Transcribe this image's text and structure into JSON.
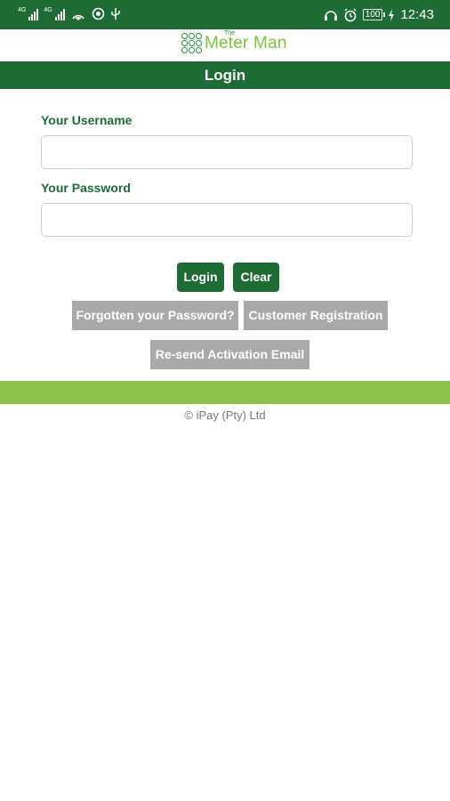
{
  "status_bar": {
    "signal1_label": "4G",
    "signal2_label": "4G",
    "battery": "100",
    "time": "12:43"
  },
  "brand": {
    "small_text": "The",
    "name": "Meter Man"
  },
  "page": {
    "title": "Login"
  },
  "form": {
    "username_label": "Your Username",
    "username_value": "",
    "password_label": "Your Password",
    "password_value": ""
  },
  "buttons": {
    "login": "Login",
    "clear": "Clear",
    "forgot": "Forgotten your Password?",
    "register": "Customer Registration",
    "resend": "Re-send Activation Email"
  },
  "footer": {
    "copyright": "© iPay (Pty) Ltd"
  },
  "colors": {
    "primary_green": "#1e6b36",
    "accent_green": "#8bc34a",
    "gray_button": "#a9a9a9"
  }
}
